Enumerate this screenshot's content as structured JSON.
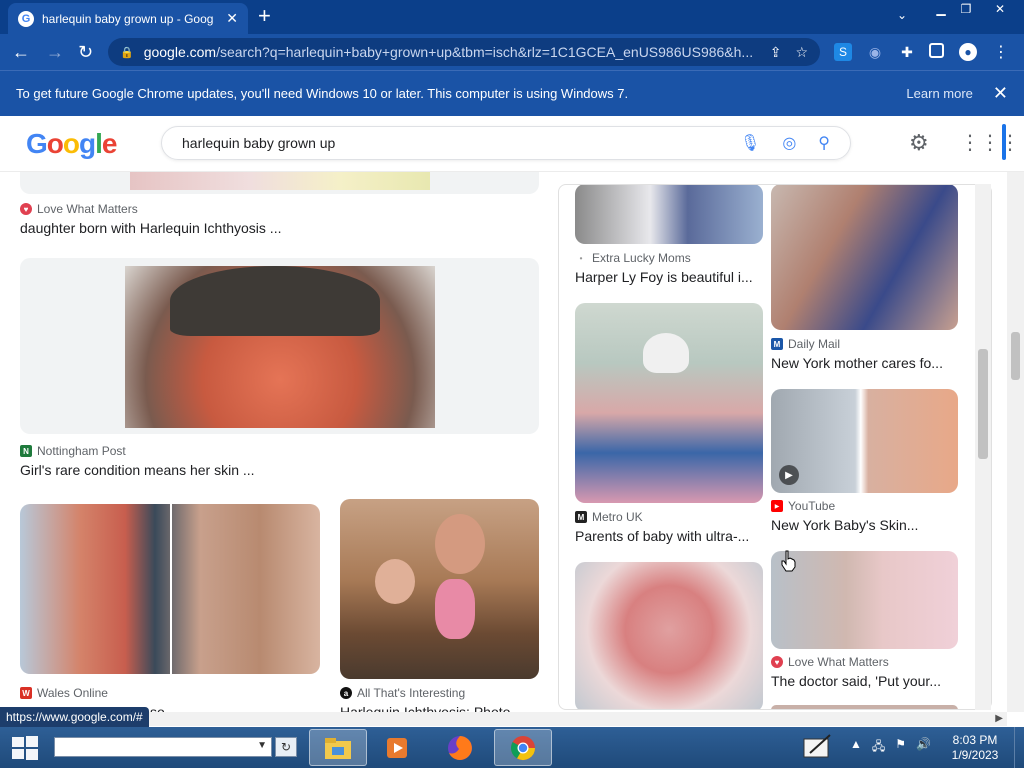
{
  "browser": {
    "tab_title": "harlequin baby grown up - Goog",
    "new_tab": "+",
    "url_host": "google.com",
    "url_rest": "/search?q=harlequin+baby+grown+up&tbm=isch&rlz=1C1GCEA_enUS986US986&h...",
    "infobar_message": "To get future Google Chrome updates, you'll need Windows 10 or later. This computer is using Windows 7.",
    "infobar_link": "Learn more",
    "status_url": "https://www.google.com/#"
  },
  "google": {
    "logo": [
      "G",
      "o",
      "o",
      "g",
      "l",
      "e"
    ],
    "query": "harlequin baby grown up"
  },
  "left_results": [
    {
      "source": "Love What Matters",
      "caption": "daughter born with Harlequin Ichthyosis ...",
      "icon_color": "#e04050"
    },
    {
      "source": "Nottingham Post",
      "caption": "Girl's rare condition means her skin ...",
      "icon_color": "#1e7a3c",
      "icon_letter": "N"
    },
    {
      "source": "Wales Online",
      "caption": "... whose skin grows so ...",
      "icon_color": "#d93025",
      "icon_letter": "W"
    },
    {
      "source": "All That's Interesting",
      "caption": "Harlequin Ichthyosis: Photo ...",
      "icon_color": "#111111",
      "icon_letter": "a"
    }
  ],
  "right_results": [
    {
      "source": "Extra Lucky Moms",
      "caption": "Harper Ly Foy is beautiful i...",
      "icon_color": "#999999"
    },
    {
      "source": "Daily Mail",
      "caption": "New York mother cares fo...",
      "icon_color": "#1a56a8",
      "icon_letter": "M"
    },
    {
      "source": "Metro UK",
      "caption": "Parents of baby with ultra-...",
      "icon_color": "#222222",
      "icon_letter": "M"
    },
    {
      "source": "YouTube",
      "caption": "New York Baby's Skin...",
      "icon_color": "#ff0000",
      "icon_letter": "▶"
    },
    {
      "source": "Love What Matters",
      "caption": "The doctor said, 'Put your...",
      "icon_color": "#e04050"
    }
  ],
  "taskbar": {
    "time": "8:03 PM",
    "date": "1/9/2023"
  }
}
